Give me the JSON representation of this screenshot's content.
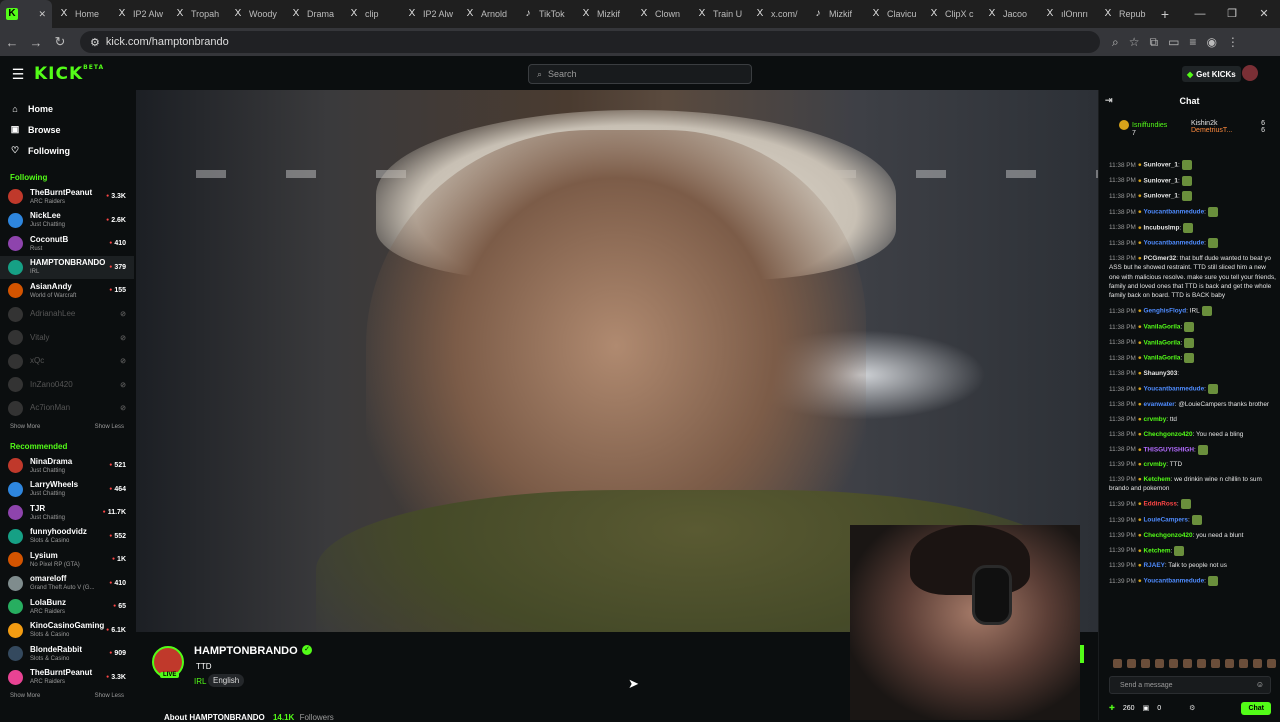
{
  "browser": {
    "tabs": [
      {
        "label": "",
        "icon": "kick-icon",
        "active": true
      },
      {
        "label": "Home",
        "icon": "x-icon"
      },
      {
        "label": "IP2 Alw",
        "icon": "x-icon"
      },
      {
        "label": "Tropah",
        "icon": "x-icon"
      },
      {
        "label": "Woody",
        "icon": "x-icon"
      },
      {
        "label": "Drama",
        "icon": "x-icon"
      },
      {
        "label": "clip",
        "icon": "x-icon"
      },
      {
        "label": "IP2 Alw",
        "icon": "x-icon"
      },
      {
        "label": "Arnold",
        "icon": "x-icon"
      },
      {
        "label": "TikTok",
        "icon": "tiktok-icon"
      },
      {
        "label": "Mizkif",
        "icon": "x-icon"
      },
      {
        "label": "Clown",
        "icon": "x-icon"
      },
      {
        "label": "Train U",
        "icon": "x-icon"
      },
      {
        "label": "x.com/",
        "icon": "x-icon"
      },
      {
        "label": "Mizkif",
        "icon": "tiktok-icon"
      },
      {
        "label": "Clavicu",
        "icon": "x-icon"
      },
      {
        "label": "ClipX c",
        "icon": "x-icon"
      },
      {
        "label": "Jacoo",
        "icon": "x-icon"
      },
      {
        "label": "ılOnnrı",
        "icon": "x-icon"
      },
      {
        "label": "Repub",
        "icon": "x-icon"
      }
    ],
    "url": "kick.com/hamptonbrando"
  },
  "header": {
    "logo": "KICK",
    "logo_sup": "BETA",
    "search_placeholder": "Search",
    "get_kicks": "Get KICKs"
  },
  "sidebar": {
    "nav": [
      {
        "label": "Home",
        "icon": "home-icon"
      },
      {
        "label": "Browse",
        "icon": "browse-icon"
      },
      {
        "label": "Following",
        "icon": "heart-icon"
      }
    ],
    "following_title": "Following",
    "following": [
      {
        "name": "TheBurntPeanut",
        "category": "ARC Raiders",
        "viewers": "3.3K",
        "live": true
      },
      {
        "name": "NickLee",
        "category": "Just Chatting",
        "viewers": "2.6K",
        "live": true
      },
      {
        "name": "CoconutB",
        "category": "Rust",
        "viewers": "410",
        "live": true
      },
      {
        "name": "HAMPTONBRANDO",
        "category": "IRL",
        "viewers": "379",
        "live": true,
        "selected": true
      },
      {
        "name": "AsianAndy",
        "category": "World of Warcraft",
        "viewers": "155",
        "live": true
      },
      {
        "name": "AdrianahLee",
        "category": "",
        "viewers": "",
        "live": false
      },
      {
        "name": "Vitaly",
        "category": "",
        "viewers": "",
        "live": false
      },
      {
        "name": "xQc",
        "category": "",
        "viewers": "",
        "live": false
      },
      {
        "name": "InZano0420",
        "category": "",
        "viewers": "",
        "live": false
      },
      {
        "name": "Ac7ionMan",
        "category": "",
        "viewers": "",
        "live": false
      }
    ],
    "show_more": "Show More",
    "show_less": "Show Less",
    "recommended_title": "Recommended",
    "recommended": [
      {
        "name": "NinaDrama",
        "category": "Just Chatting",
        "viewers": "521"
      },
      {
        "name": "LarryWheels",
        "category": "Just Chatting",
        "viewers": "464"
      },
      {
        "name": "TJR",
        "category": "Just Chatting",
        "viewers": "11.7K"
      },
      {
        "name": "funnyhoodvidz",
        "category": "Slots & Casino",
        "viewers": "552"
      },
      {
        "name": "Lysium",
        "category": "No Pixel RP (GTA)",
        "viewers": "1K"
      },
      {
        "name": "omareloff",
        "category": "Grand Theft Auto V (G...",
        "viewers": "410"
      },
      {
        "name": "LolaBunz",
        "category": "ARC Raiders",
        "viewers": "65"
      },
      {
        "name": "KinoCasinoGaming",
        "category": "Slots & Casino",
        "viewers": "6.1K"
      },
      {
        "name": "BlondeRabbit",
        "category": "Slots & Casino",
        "viewers": "909"
      },
      {
        "name": "TheBurntPeanut",
        "category": "ARC Raiders",
        "viewers": "3.3K"
      }
    ]
  },
  "stream": {
    "name": "HAMPTONBRANDO",
    "live_badge": "LIVE",
    "title": "TTD",
    "category": "IRL",
    "language": "English",
    "about": "About HAMPTONBRANDO",
    "followers": "14.1K",
    "followers_label": "Followers"
  },
  "chat": {
    "title": "Chat",
    "pinned": [
      {
        "name": "Isniffundies",
        "count": "7"
      },
      {
        "name": "Kishin2k",
        "count": "6"
      },
      {
        "name": "DemetriusT...",
        "count": "6"
      }
    ],
    "messages": [
      {
        "time": "11:38 PM",
        "user": "Sunlover_1",
        "color": "#e6e6e6",
        "text": ":",
        "emote": true
      },
      {
        "time": "11:38 PM",
        "user": "Sunlover_1",
        "color": "#e6e6e6",
        "text": ":",
        "emote": true
      },
      {
        "time": "11:38 PM",
        "user": "Sunlover_1",
        "color": "#e6e6e6",
        "text": ":",
        "emote": true
      },
      {
        "time": "11:38 PM",
        "user": "Youcantbanmedude",
        "color": "#4f8cff",
        "text": ":",
        "emote": true
      },
      {
        "time": "11:38 PM",
        "user": "IncubusImp",
        "color": "#e6e6e6",
        "text": ":",
        "emote": true
      },
      {
        "time": "11:38 PM",
        "user": "Youcantbanmedude",
        "color": "#4f8cff",
        "text": ":",
        "emote": true
      },
      {
        "time": "11:38 PM",
        "user": "PCGmer32",
        "color": "#e6e6e6",
        "text": ": that buff dude wanted to beat yo ASS but he showed restraint. TTD still sliced him a new one with malicious resolve. make sure you tell your friends, family and loved ones that TTD is back and get the whole family back on board. TTD is BACK baby",
        "emote": false
      },
      {
        "time": "11:38 PM",
        "user": "GenghisFloyd",
        "color": "#4f8cff",
        "text": ": IRL",
        "emote": true
      },
      {
        "time": "11:38 PM",
        "user": "VanilaGorila",
        "color": "#53fc18",
        "text": ":",
        "emote": true
      },
      {
        "time": "11:38 PM",
        "user": "VanilaGorila",
        "color": "#53fc18",
        "text": ":",
        "emote": true
      },
      {
        "time": "11:38 PM",
        "user": "VanilaGorila",
        "color": "#53fc18",
        "text": ":",
        "emote": true
      },
      {
        "time": "11:38 PM",
        "user": "Shauny303",
        "color": "#e6e6e6",
        "text": ":",
        "emote": false
      },
      {
        "time": "11:38 PM",
        "user": "Youcantbanmedude",
        "color": "#4f8cff",
        "text": ":",
        "emote": true
      },
      {
        "time": "11:38 PM",
        "user": "evanwater",
        "color": "#4f8cff",
        "text": ": @LouieCampers thanks brother",
        "emote": false
      },
      {
        "time": "11:38 PM",
        "user": "crvmby",
        "color": "#53fc18",
        "text": ": ttd",
        "emote": false
      },
      {
        "time": "11:38 PM",
        "user": "Chechgonzo420",
        "color": "#53fc18",
        "text": ": You need a bling",
        "emote": false
      },
      {
        "time": "11:38 PM",
        "user": "THISGUYISHIGH",
        "color": "#b36bff",
        "text": ":",
        "emote": true
      },
      {
        "time": "11:39 PM",
        "user": "crvmby",
        "color": "#53fc18",
        "text": ": TTD",
        "emote": false
      },
      {
        "time": "11:39 PM",
        "user": "Ketchem",
        "color": "#53fc18",
        "text": ": we drinkin wine n chillin to sum brando and pokemon",
        "emote": false
      },
      {
        "time": "11:39 PM",
        "user": "EddinRoss",
        "color": "#ff4646",
        "text": ":",
        "emote": true
      },
      {
        "time": "11:39 PM",
        "user": "LouieCampers",
        "color": "#4f8cff",
        "text": ":",
        "emote": true
      },
      {
        "time": "11:39 PM",
        "user": "Chechgonzo420",
        "color": "#53fc18",
        "text": ": you need a blunt",
        "emote": false
      },
      {
        "time": "11:39 PM",
        "user": "Ketchem",
        "color": "#53fc18",
        "text": ":",
        "emote": true
      },
      {
        "time": "11:39 PM",
        "user": "RJAEY",
        "color": "#4f8cff",
        "text": ": Talk to people not us",
        "emote": false
      },
      {
        "time": "11:39 PM",
        "user": "Youcantbanmedude",
        "color": "#4f8cff",
        "text": ":",
        "emote": true
      }
    ],
    "send_placeholder": "Send a message",
    "points": "260",
    "subs": "0",
    "chat_button": "Chat"
  }
}
